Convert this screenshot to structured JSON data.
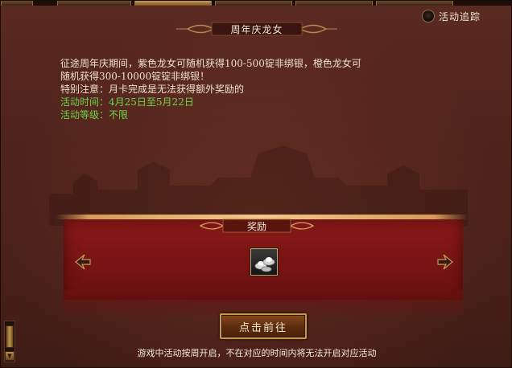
{
  "track": {
    "label": "活动追踪"
  },
  "title": "周年庆龙女",
  "description": {
    "line1": "征途周年庆期间，紫色龙女可随机获得100-500锭非绑银，橙色龙女可",
    "line2": "随机获得300-10000锭锭非绑银！",
    "line3": "特别注意：月卡完成是无法获得额外奖励的",
    "time_label": "活动时间：",
    "time_value": "4月25日至5月22日",
    "level_label": "活动等级：",
    "level_value": "不限"
  },
  "reward": {
    "title": "奖励",
    "item_icon": "silver-ingot-icon"
  },
  "button": {
    "goto_label": "点击前往"
  },
  "footer_note": "游戏中活动按周开启，不在对应的时间内将无法开启对应活动",
  "scrollbar": {
    "down_icon": "▼"
  },
  "colors": {
    "highlight_green": "#6fd24a",
    "reward_red": "#7a1414",
    "gold_border": "#c49a52"
  }
}
